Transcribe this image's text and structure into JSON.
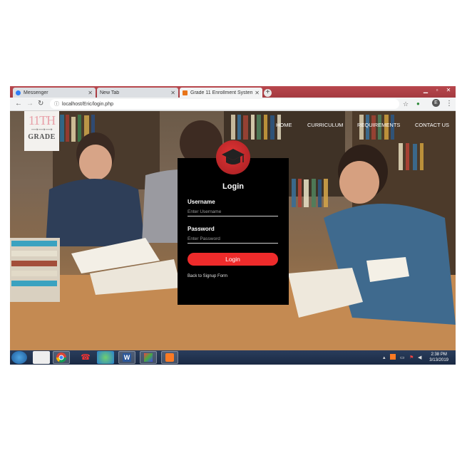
{
  "browser": {
    "tabs": [
      {
        "title": "Messenger",
        "icon_color": "#2f7df6"
      },
      {
        "title": "New Tab",
        "icon_color": ""
      },
      {
        "title": "Grade 11 Enrollment System",
        "icon_color": "#e8751a",
        "active": true
      }
    ],
    "url": "localhost/Eric/login.php"
  },
  "site": {
    "logo": {
      "big": "11TH",
      "arrow": "⟶⟶⟶",
      "small": "GRADE"
    },
    "nav": [
      "HOME",
      "CURRICULUM",
      "REQUIREMENTS",
      "CONTACT US"
    ]
  },
  "login": {
    "title": "Login",
    "username_label": "Username",
    "username_placeholder": "Enter Username",
    "password_label": "Password",
    "password_placeholder": "Enter Password",
    "button": "Login",
    "signup_link": "Back to Signup Form"
  },
  "taskbar": {
    "time": "2:38 PM",
    "date": "3/13/2019"
  }
}
